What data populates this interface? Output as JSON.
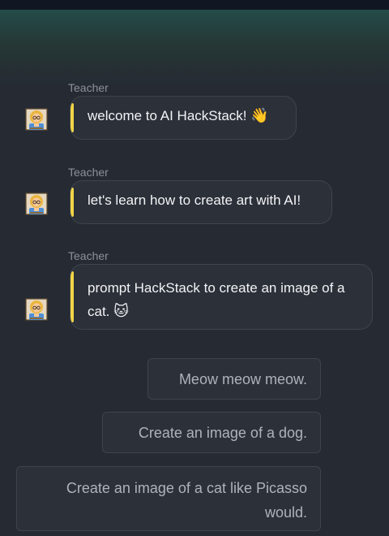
{
  "chat": {
    "messages": [
      {
        "sender": "Teacher",
        "text": "welcome to AI HackStack!",
        "emoji": "👋",
        "avatar_icon": "teacher-avatar-icon"
      },
      {
        "sender": "Teacher",
        "text": "let's learn how to create art with AI!",
        "emoji": "",
        "avatar_icon": "teacher-avatar-icon"
      },
      {
        "sender": "Teacher",
        "text": "prompt HackStack to create an image of a cat.",
        "emoji": "🐱",
        "avatar_icon": "teacher-avatar-icon"
      }
    ],
    "accent_color": "#f2d448"
  },
  "choices": [
    {
      "label": "Meow meow meow."
    },
    {
      "label": "Create an image of a dog."
    },
    {
      "label": "Create an image of a cat like Picasso would."
    }
  ]
}
